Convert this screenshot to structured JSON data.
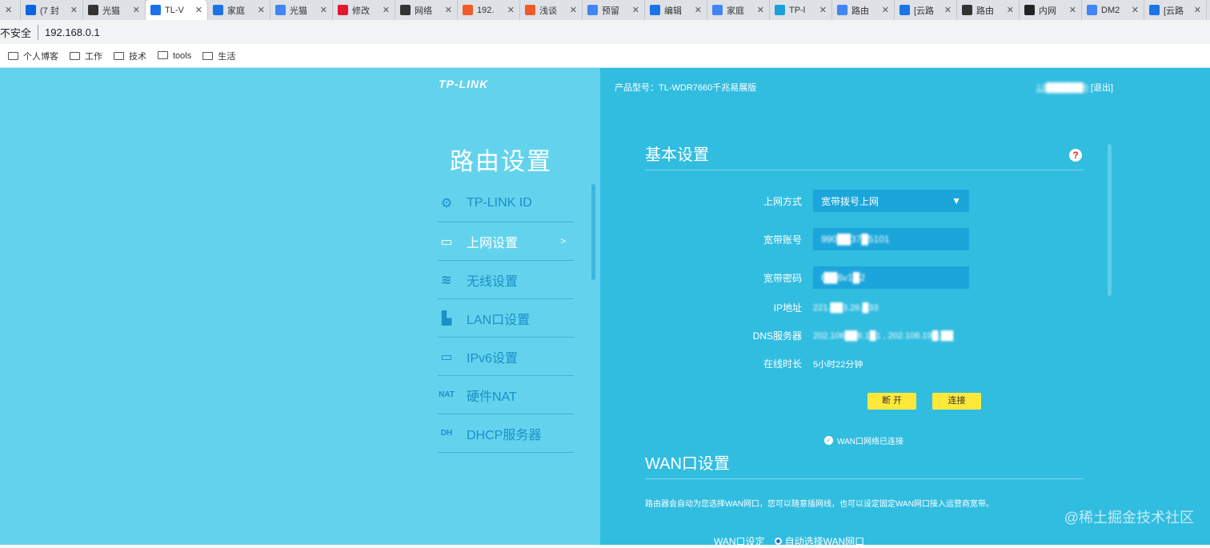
{
  "browser": {
    "tabs": [
      {
        "label": "",
        "icon": "generic",
        "color": "#999"
      },
      {
        "label": "(7 封",
        "icon": "zhihu-icon",
        "color": "#0a66e0"
      },
      {
        "label": "光猫",
        "icon": "router-icon",
        "color": "#333"
      },
      {
        "label": "TL-V",
        "icon": "tp-icon",
        "color": "#1a73e8",
        "active": true
      },
      {
        "label": "家庭",
        "icon": "confluence-icon",
        "color": "#1a73e8"
      },
      {
        "label": "光猫",
        "icon": "google-icon",
        "color": "#4285f4"
      },
      {
        "label": "修改",
        "icon": "weibo-icon",
        "color": "#e6162d"
      },
      {
        "label": "网络",
        "icon": "wikipedia-icon",
        "color": "#333"
      },
      {
        "label": "192.",
        "icon": "csdn-icon",
        "color": "#f05a28"
      },
      {
        "label": "浅谈",
        "icon": "csdn-icon",
        "color": "#f05a28"
      },
      {
        "label": "预留",
        "icon": "cloud-icon",
        "color": "#4285f4"
      },
      {
        "label": "编辑",
        "icon": "confluence-icon",
        "color": "#1a73e8"
      },
      {
        "label": "家庭",
        "icon": "google-icon",
        "color": "#4285f4"
      },
      {
        "label": "TP-l",
        "icon": "tp-circle-icon",
        "color": "#1b9fd8"
      },
      {
        "label": "路由",
        "icon": "google-icon",
        "color": "#4285f4"
      },
      {
        "label": "[云路",
        "icon": "tp-icon",
        "color": "#1a73e8"
      },
      {
        "label": "路由",
        "icon": "router-icon",
        "color": "#333"
      },
      {
        "label": "内网",
        "icon": "m-icon",
        "color": "#222"
      },
      {
        "label": "DM2",
        "icon": "google-icon",
        "color": "#4285f4"
      },
      {
        "label": "[云路",
        "icon": "tp-icon",
        "color": "#1a73e8"
      }
    ],
    "security": "不安全",
    "url": "192.168.0.1",
    "bookmarks": [
      "个人博客",
      "工作",
      "技术",
      "tools",
      "生活"
    ]
  },
  "router": {
    "logo": "TP-LINK",
    "sidebar_title": "路由设置",
    "menu": [
      {
        "label": "TP-LINK ID",
        "icon": "⚙",
        "name": "gear-icon"
      },
      {
        "label": "上网设置",
        "icon": "▭",
        "name": "laptop-icon",
        "active": true,
        "chevron": ">"
      },
      {
        "label": "无线设置",
        "icon": "≋",
        "name": "wifi-icon"
      },
      {
        "label": "LAN口设置",
        "icon": "▙",
        "name": "lan-port-icon"
      },
      {
        "label": "IPv6设置",
        "icon": "▭",
        "name": "laptop-icon"
      },
      {
        "label": "硬件NAT",
        "icon": "NAT",
        "name": "nat-icon"
      },
      {
        "label": "DHCP服务器",
        "icon": "DH",
        "name": "dhcp-icon"
      }
    ],
    "model": "产品型号：TL-WDR7660千兆易展版",
    "user": "13██████6",
    "logout": "[退出]",
    "basic": {
      "title": "基本设置",
      "help": "?",
      "mode_label": "上网方式",
      "mode_value": "宽带拨号上网",
      "account_label": "宽带账号",
      "account_value": "990██37█5101",
      "password_label": "宽带密码",
      "password_value": "t██6v1█2",
      "ip_label": "IP地址",
      "ip_value": "221.██3.26.█33",
      "dns_label": "DNS服务器",
      "dns_value": "202.106██6.1█1 , 202.106.19█.██",
      "uptime_label": "在线时长",
      "uptime_value": "5小时22分钟",
      "disconnect": "断 开",
      "connect": "连接",
      "status": "WAN口网络已连接"
    },
    "wan": {
      "title": "WAN口设置",
      "desc": "路由器会自动为您选择WAN网口，您可以随意插网线，也可以设定固定WAN网口接入运营商宽带。",
      "setting_label": "WAN口设定",
      "option": "自动选择WAN网口"
    },
    "watermark": "@稀土掘金技术社区"
  }
}
